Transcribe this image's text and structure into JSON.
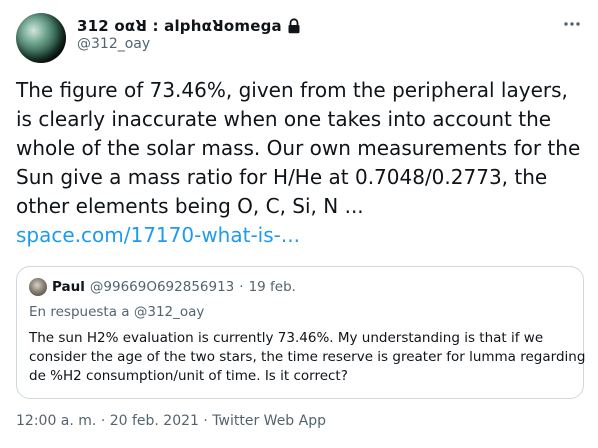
{
  "author": {
    "display_name": "312 oαꓤ : alphαꓤomega",
    "handle": "@312_oay",
    "avatar_icon": "planet-avatar",
    "protected_icon": "lock-icon"
  },
  "more_icon": "more-horizontal-icon",
  "tweet": {
    "lines": [
      "The figure of 73.46%, given from the peripheral layers,",
      "is clearly inaccurate when one takes into account the",
      "whole of the solar mass. Our own measurements for the",
      "Sun give a mass ratio for H/He at 0.7048/0.2773, the",
      "other elements being O, C, Si, N ..."
    ],
    "link": "space.com/17170-what-is-..."
  },
  "quoted": {
    "name": "Paul",
    "handle": "@99669O692856913",
    "separator": "·",
    "date": "19 feb.",
    "reply_prefix": "En respuesta a",
    "reply_handle": "@312_oay",
    "lines": [
      "The sun H2% evaluation is currently 73.46%. My understanding is that if we",
      "consider the age of the two stars, the time reserve is greater for lumma regarding",
      "de %H2 consumption/unit of time. Is it correct?"
    ]
  },
  "footer": {
    "timestamp": "12:00 a. m. · 20 feb. 2021 · ",
    "app": "Twitter Web App"
  },
  "colors": {
    "link": "#1d9bf0",
    "secondary_text": "#536471",
    "border": "#cfd9de"
  }
}
